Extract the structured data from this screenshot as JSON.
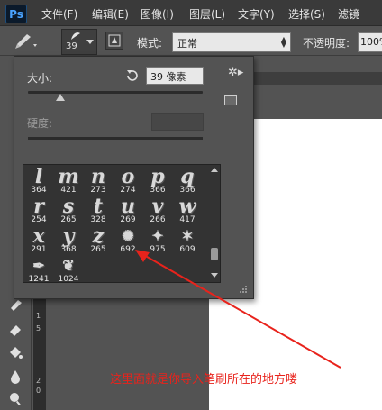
{
  "app": {
    "logo": "Ps"
  },
  "menu": [
    "文件(F)",
    "编辑(E)",
    "图像(I)",
    "图层(L)",
    "文字(Y)",
    "选择(S)",
    "滤镜"
  ],
  "options": {
    "brush_size": "39",
    "mode_label": "模式:",
    "mode_value": "正常",
    "opacity_label": "不透明度:",
    "opacity_value": "100%"
  },
  "brush_panel": {
    "size_label": "大小:",
    "size_value": "39 像素",
    "size_fraction": 0.2,
    "hardness_label": "硬度:"
  },
  "presets": [
    {
      "glyph": "l",
      "size": "364"
    },
    {
      "glyph": "m",
      "size": "421"
    },
    {
      "glyph": "n",
      "size": "273"
    },
    {
      "glyph": "o",
      "size": "274"
    },
    {
      "glyph": "p",
      "size": "366"
    },
    {
      "glyph": "q",
      "size": "366"
    },
    {
      "glyph": "r",
      "size": "254"
    },
    {
      "glyph": "s",
      "size": "265"
    },
    {
      "glyph": "t",
      "size": "328"
    },
    {
      "glyph": "u",
      "size": "269"
    },
    {
      "glyph": "v",
      "size": "266"
    },
    {
      "glyph": "w",
      "size": "417"
    },
    {
      "glyph": "x",
      "size": "291"
    },
    {
      "glyph": "y",
      "size": "368"
    },
    {
      "glyph": "z",
      "size": "265"
    },
    {
      "glyph": "✺",
      "size": "692"
    },
    {
      "glyph": "✦",
      "size": "975"
    },
    {
      "glyph": "✶",
      "size": "609"
    },
    {
      "glyph": "✒",
      "size": "1241"
    },
    {
      "glyph": "❦",
      "size": "1024"
    }
  ],
  "ruler": [
    "1",
    "5",
    "2",
    "0"
  ],
  "annotation": {
    "text": "这里面就是你导入笔刷所在的地方喽",
    "color": "#e8231c"
  }
}
